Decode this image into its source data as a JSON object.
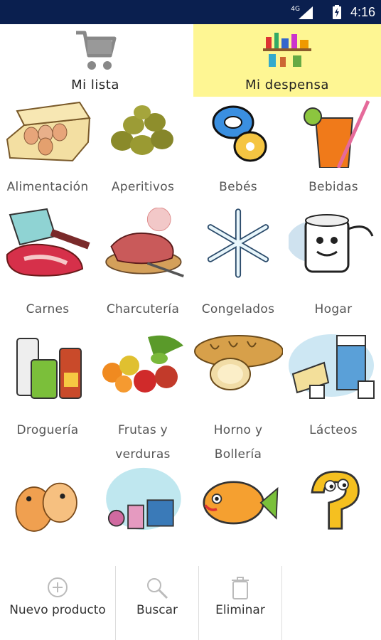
{
  "status": {
    "time": "4:16",
    "network": "4G"
  },
  "tabs": [
    {
      "label": "Mi lista",
      "icon": "cart-icon",
      "selected": false
    },
    {
      "label": "Mi despensa",
      "icon": "pantry-shelf-icon",
      "selected": true
    }
  ],
  "categories": [
    {
      "label": "Alimentación",
      "icon": "eggs-carton-icon"
    },
    {
      "label": "Aperitivos",
      "icon": "olives-icon"
    },
    {
      "label": "Bebés",
      "icon": "pacifier-icon"
    },
    {
      "label": "Bebidas",
      "icon": "drink-glass-icon"
    },
    {
      "label": "Carnes",
      "icon": "meat-cleaver-icon"
    },
    {
      "label": "Charcutería",
      "icon": "cold-cuts-icon"
    },
    {
      "label": "Congelados",
      "icon": "snowflake-icon"
    },
    {
      "label": "Hogar",
      "icon": "toilet-paper-icon"
    },
    {
      "label": "Droguería",
      "icon": "cleaning-products-icon"
    },
    {
      "label": "Frutas y",
      "label2": "verduras",
      "icon": "fruits-vegetables-icon"
    },
    {
      "label": "Horno y",
      "label2": "Bollería",
      "icon": "bread-icon"
    },
    {
      "label": "Lácteos",
      "icon": "dairy-icon"
    },
    {
      "label": "",
      "icon": "pets-icon"
    },
    {
      "label": "",
      "icon": "perfume-icon"
    },
    {
      "label": "",
      "icon": "fish-icon"
    },
    {
      "label": "",
      "icon": "question-mark-icon"
    }
  ],
  "bottom_bar": {
    "new_product": "Nuevo producto",
    "search": "Buscar",
    "delete": "Eliminar"
  },
  "colors": {
    "selected_tab": "#fef693",
    "status_bar": "#0a1f4f"
  }
}
